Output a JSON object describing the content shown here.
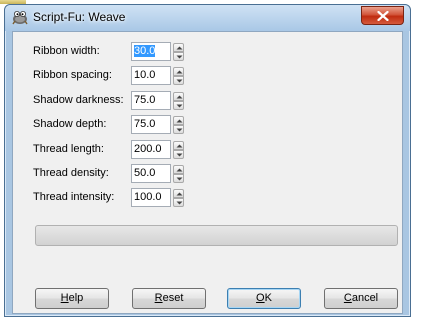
{
  "window": {
    "title": "Script-Fu: Weave",
    "icon": "gimp-wilber-icon",
    "close_icon": "close-icon"
  },
  "params": [
    {
      "label": "Ribbon width:",
      "value": "30.0",
      "selected": true
    },
    {
      "label": "Ribbon spacing:",
      "value": "10.0",
      "selected": false
    },
    {
      "label": "Shadow darkness:",
      "value": "75.0",
      "selected": false
    },
    {
      "label": "Shadow depth:",
      "value": "75.0",
      "selected": false
    },
    {
      "label": "Thread length:",
      "value": "200.0",
      "selected": false
    },
    {
      "label": "Thread density:",
      "value": "50.0",
      "selected": false
    },
    {
      "label": "Thread intensity:",
      "value": "100.0",
      "selected": false
    }
  ],
  "progress": {
    "fraction": 0
  },
  "buttons": {
    "help": {
      "mnemonic": "H",
      "rest": "elp"
    },
    "reset": {
      "mnemonic": "R",
      "rest": "eset"
    },
    "ok": {
      "mnemonic": "O",
      "rest": "K"
    },
    "cancel": {
      "mnemonic": "C",
      "rest": "ancel"
    }
  },
  "colors": {
    "title_bar": "#a9c8e6",
    "close_button": "#c02c10",
    "selection": "#3399ff",
    "dialog_bg": "#f0f0f0"
  }
}
